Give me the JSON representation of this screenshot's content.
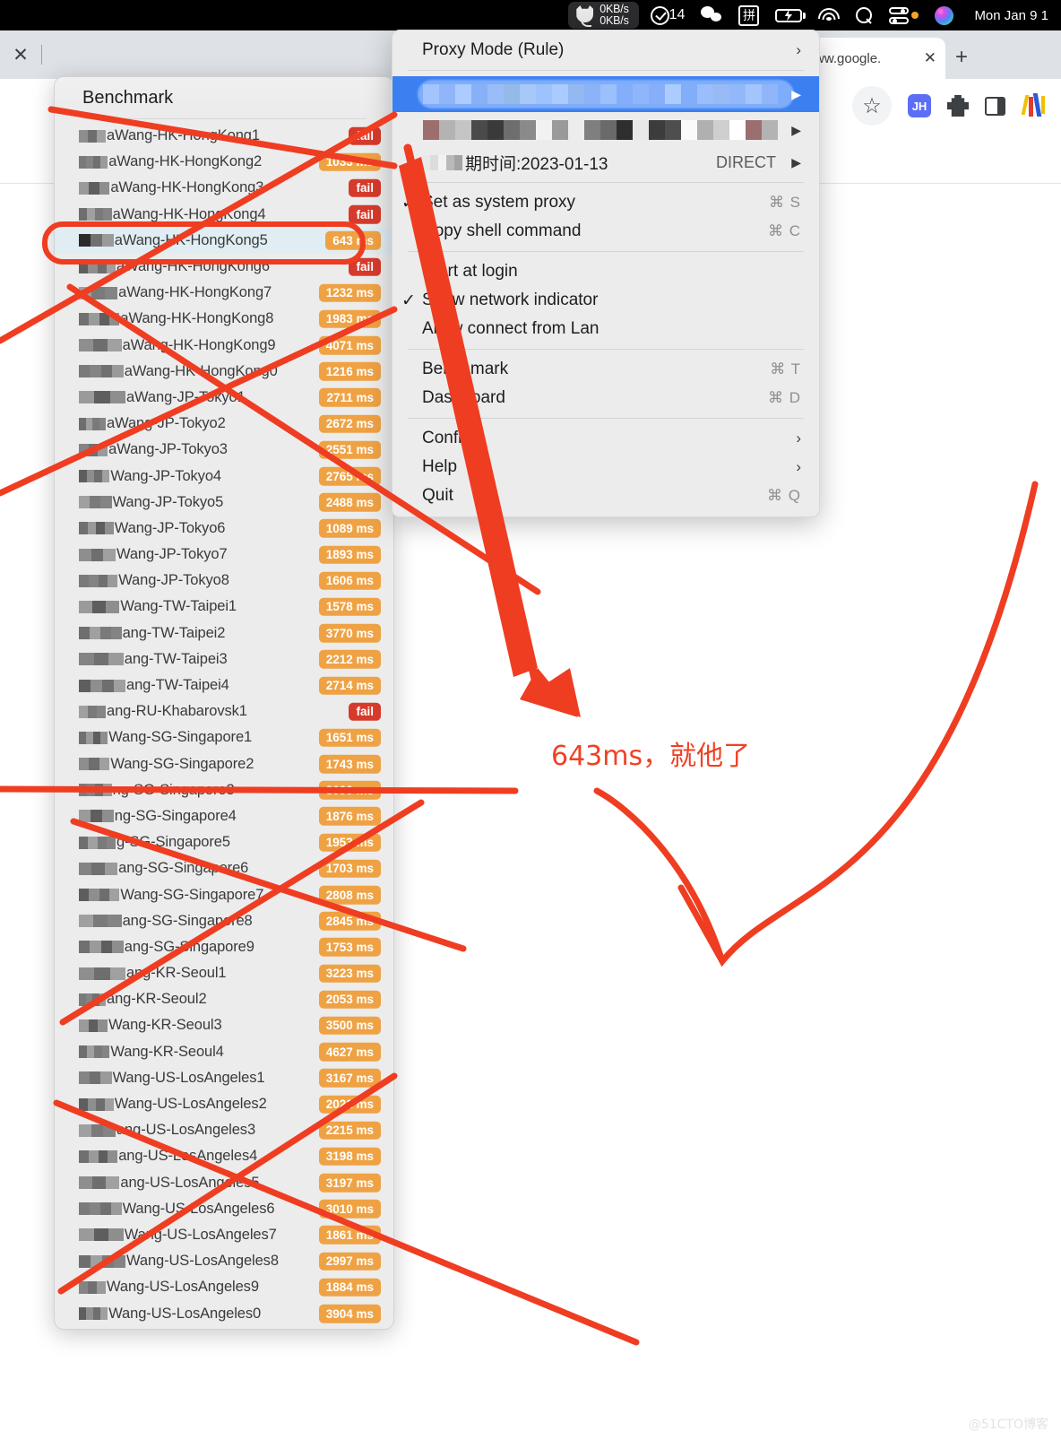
{
  "menubar": {
    "clash_icon": "cat-icon",
    "upload_speed": "0KB/s",
    "download_speed": "0KB/s",
    "checkmark_icon": "checkmark-circle-icon",
    "checkmark_count": "14",
    "wechat_icon": "wechat-icon",
    "ime_icon": "pinyin-input-icon",
    "ime_label": "拼",
    "battery_icon": "battery-charging-icon",
    "wifi_icon": "wifi-icon",
    "search_icon": "search-icon",
    "control_center_icon": "control-center-icon",
    "siri_icon": "siri-icon",
    "clock": "Mon Jan 9  1"
  },
  "chrome": {
    "close_icon": "close-icon",
    "tab_title": "ww.google.",
    "tab_close_icon": "close-icon",
    "new_tab_icon": "plus-icon",
    "bookmark_icon": "star-icon",
    "extension_jh_label": "JH",
    "puzzle_icon": "puzzle-extensions-icon",
    "side_panel_icon": "side-panel-icon",
    "profile_icon": "profile-avatar-icon"
  },
  "benchmark": {
    "title": "Benchmark",
    "selected_index": 4,
    "rows": [
      {
        "name": "aWang-HK-HongKong1",
        "value": "fail",
        "state": "fail"
      },
      {
        "name": "aWang-HK-HongKong2",
        "value": "1033 ms",
        "state": "ok"
      },
      {
        "name": "aWang-HK-HongKong3",
        "value": "fail",
        "state": "fail"
      },
      {
        "name": "aWang-HK-HongKong4",
        "value": "fail",
        "state": "fail"
      },
      {
        "name": "aWang-HK-HongKong5",
        "value": "643 ms",
        "state": "ok"
      },
      {
        "name": "aWang-HK-HongKong6",
        "value": "fail",
        "state": "fail"
      },
      {
        "name": "aWang-HK-HongKong7",
        "value": "1232 ms",
        "state": "ok"
      },
      {
        "name": "aWang-HK-HongKong8",
        "value": "1983 ms",
        "state": "ok"
      },
      {
        "name": "aWang-HK-HongKong9",
        "value": "4071 ms",
        "state": "ok"
      },
      {
        "name": "aWang-HK-HongKong0",
        "value": "1216 ms",
        "state": "ok"
      },
      {
        "name": "aWang-JP-Tokyo1",
        "value": "2711 ms",
        "state": "ok"
      },
      {
        "name": "aWang-JP-Tokyo2",
        "value": "2672 ms",
        "state": "ok"
      },
      {
        "name": "aWang-JP-Tokyo3",
        "value": "2551 ms",
        "state": "ok"
      },
      {
        "name": "Wang-JP-Tokyo4",
        "value": "2765 ms",
        "state": "ok"
      },
      {
        "name": "Wang-JP-Tokyo5",
        "value": "2488 ms",
        "state": "ok"
      },
      {
        "name": "Wang-JP-Tokyo6",
        "value": "1089 ms",
        "state": "ok"
      },
      {
        "name": "Wang-JP-Tokyo7",
        "value": "1893 ms",
        "state": "ok"
      },
      {
        "name": "Wang-JP-Tokyo8",
        "value": "1606 ms",
        "state": "ok"
      },
      {
        "name": "Wang-TW-Taipei1",
        "value": "1578 ms",
        "state": "ok"
      },
      {
        "name": "ang-TW-Taipei2",
        "value": "3770 ms",
        "state": "ok"
      },
      {
        "name": "ang-TW-Taipei3",
        "value": "2212 ms",
        "state": "ok"
      },
      {
        "name": "ang-TW-Taipei4",
        "value": "2714 ms",
        "state": "ok"
      },
      {
        "name": "ang-RU-Khabarovsk1",
        "value": "fail",
        "state": "fail"
      },
      {
        "name": "Wang-SG-Singapore1",
        "value": "1651 ms",
        "state": "ok"
      },
      {
        "name": "Wang-SG-Singapore2",
        "value": "1743 ms",
        "state": "ok"
      },
      {
        "name": "ng-SG-Singapore3",
        "value": "3090 ms",
        "state": "ok"
      },
      {
        "name": "ng-SG-Singapore4",
        "value": "1876 ms",
        "state": "ok"
      },
      {
        "name": "g-SG-Singapore5",
        "value": "1953 ms",
        "state": "ok"
      },
      {
        "name": "ang-SG-Singapore6",
        "value": "1703 ms",
        "state": "ok"
      },
      {
        "name": "Wang-SG-Singapore7",
        "value": "2808 ms",
        "state": "ok"
      },
      {
        "name": "ang-SG-Singapore8",
        "value": "2845 ms",
        "state": "ok"
      },
      {
        "name": "ang-SG-Singapore9",
        "value": "1753 ms",
        "state": "ok"
      },
      {
        "name": "ang-KR-Seoul1",
        "value": "3223 ms",
        "state": "ok"
      },
      {
        "name": "ang-KR-Seoul2",
        "value": "2053 ms",
        "state": "ok"
      },
      {
        "name": "Wang-KR-Seoul3",
        "value": "3500 ms",
        "state": "ok"
      },
      {
        "name": "Wang-KR-Seoul4",
        "value": "4627 ms",
        "state": "ok"
      },
      {
        "name": "Wang-US-LosAngeles1",
        "value": "3167 ms",
        "state": "ok"
      },
      {
        "name": "Wang-US-LosAngeles2",
        "value": "2021 ms",
        "state": "ok"
      },
      {
        "name": "ang-US-LosAngeles3",
        "value": "2215 ms",
        "state": "ok"
      },
      {
        "name": "ang-US-LosAngeles4",
        "value": "3198 ms",
        "state": "ok"
      },
      {
        "name": "ang-US-LosAngeles5",
        "value": "3197 ms",
        "state": "ok"
      },
      {
        "name": "Wang-US-LosAngeles6",
        "value": "3010 ms",
        "state": "ok"
      },
      {
        "name": "Wang-US-LosAngeles7",
        "value": "1861 ms",
        "state": "ok"
      },
      {
        "name": "Wang-US-LosAngeles8",
        "value": "2997 ms",
        "state": "ok"
      },
      {
        "name": "Wang-US-LosAngeles9",
        "value": "1884 ms",
        "state": "ok"
      },
      {
        "name": "Wang-US-LosAngeles0",
        "value": "3904 ms",
        "state": "ok"
      }
    ]
  },
  "menu": {
    "items": [
      {
        "label": "Proxy Mode (Rule)",
        "arrow": "›",
        "type": "submenu"
      },
      {
        "type": "separator"
      },
      {
        "label": "",
        "type": "blurred-highlight",
        "tri": "▶"
      },
      {
        "label": "",
        "type": "blurred",
        "tri": "▶"
      },
      {
        "label": "期时间:2023-01-13",
        "right": "DIRECT",
        "tri": "▶",
        "type": "blurred-label"
      },
      {
        "type": "separator"
      },
      {
        "label": "Set as system proxy",
        "checked": true,
        "shortcut": "⌘ S",
        "type": "check"
      },
      {
        "label": "Copy shell command",
        "checked": false,
        "shortcut": "⌘ C",
        "type": "check"
      },
      {
        "type": "separator"
      },
      {
        "label": "Start at login",
        "checked": false,
        "type": "check"
      },
      {
        "label": "Show network indicator",
        "checked": true,
        "type": "check"
      },
      {
        "label": "Allow connect from Lan",
        "checked": false,
        "type": "check"
      },
      {
        "type": "separator"
      },
      {
        "label": "Benchmark",
        "shortcut": "⌘ T",
        "type": "action"
      },
      {
        "label": "Dashboard",
        "shortcut": "⌘ D",
        "type": "action"
      },
      {
        "type": "separator"
      },
      {
        "label": "Config",
        "arrow": "›",
        "type": "submenu"
      },
      {
        "label": "Help",
        "arrow": "›",
        "type": "submenu"
      },
      {
        "label": "Quit",
        "shortcut": "⌘ Q",
        "type": "action"
      }
    ]
  },
  "annotation": {
    "text": "643ms，就他了",
    "color": "#f04124"
  },
  "watermark": "@51CTO博客"
}
